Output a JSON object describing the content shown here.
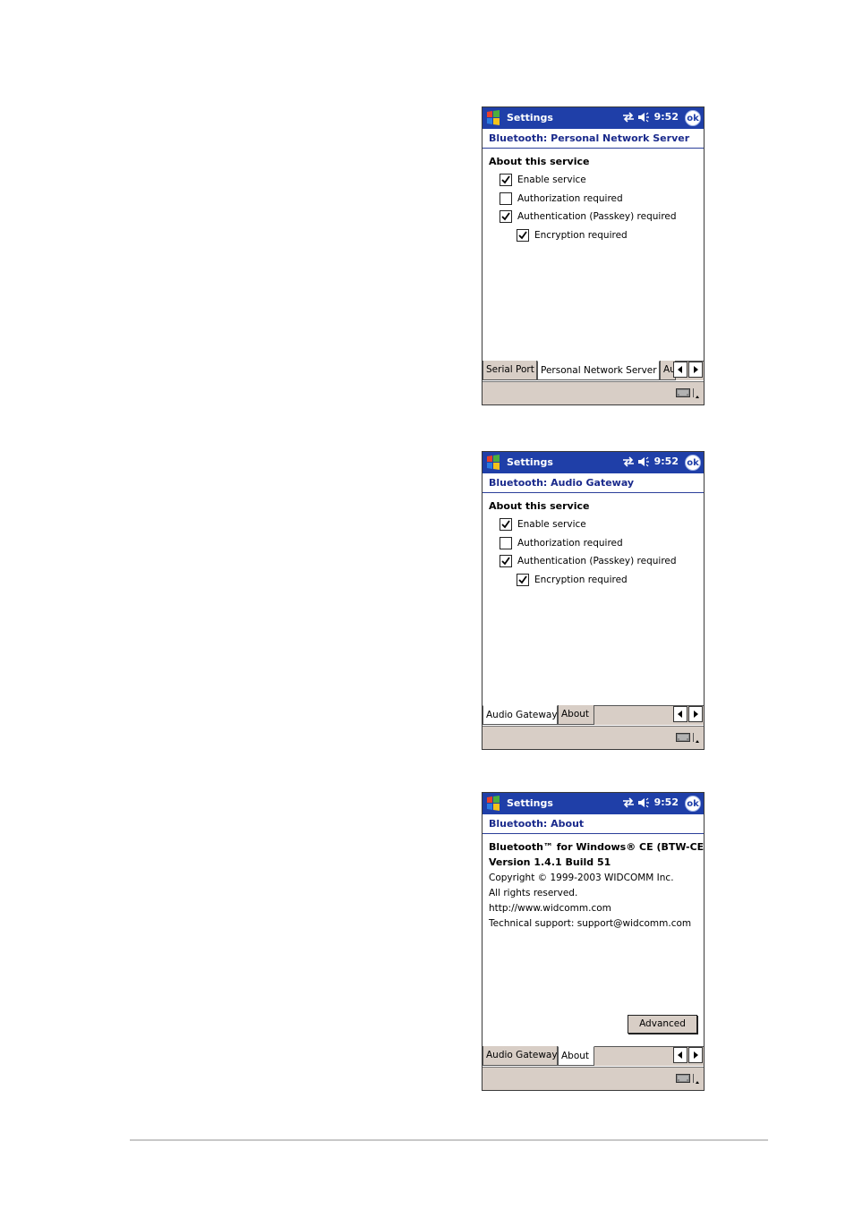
{
  "common": {
    "app_title": "Settings",
    "time": "9:52",
    "ok_label": "ok",
    "section_heading": "About this service"
  },
  "screens": [
    {
      "header": "Bluetooth: Personal Network Server",
      "options": [
        {
          "label": "Enable service",
          "checked": true
        },
        {
          "label": "Authorization required",
          "checked": false
        },
        {
          "label": "Authentication (Passkey) required",
          "checked": true
        },
        {
          "label": "Encryption required",
          "checked": true
        }
      ],
      "tabs": [
        {
          "label": "Serial Port",
          "active": false
        },
        {
          "label": "Personal Network Server",
          "active": true
        },
        {
          "label": "Au",
          "active": false
        }
      ]
    },
    {
      "header": "Bluetooth: Audio Gateway",
      "options": [
        {
          "label": "Enable service",
          "checked": true
        },
        {
          "label": "Authorization required",
          "checked": false
        },
        {
          "label": "Authentication (Passkey) required",
          "checked": true
        },
        {
          "label": "Encryption required",
          "checked": true
        }
      ],
      "tabs": [
        {
          "label": "Audio Gateway",
          "active": true
        },
        {
          "label": "About",
          "active": false
        }
      ]
    },
    {
      "header": "Bluetooth: About",
      "about": {
        "product": "Bluetooth™ for Windows® CE (BTW-CE)",
        "version": "Version 1.4.1 Build 51",
        "copyright": "Copyright © 1999-2003 WIDCOMM Inc.",
        "rights": "All rights reserved.",
        "website": "http://www.widcomm.com",
        "support": "Technical support: support@widcomm.com",
        "advanced_label": "Advanced"
      },
      "tabs": [
        {
          "label": "Audio Gateway",
          "active": false
        },
        {
          "label": "About",
          "active": true
        }
      ]
    }
  ]
}
